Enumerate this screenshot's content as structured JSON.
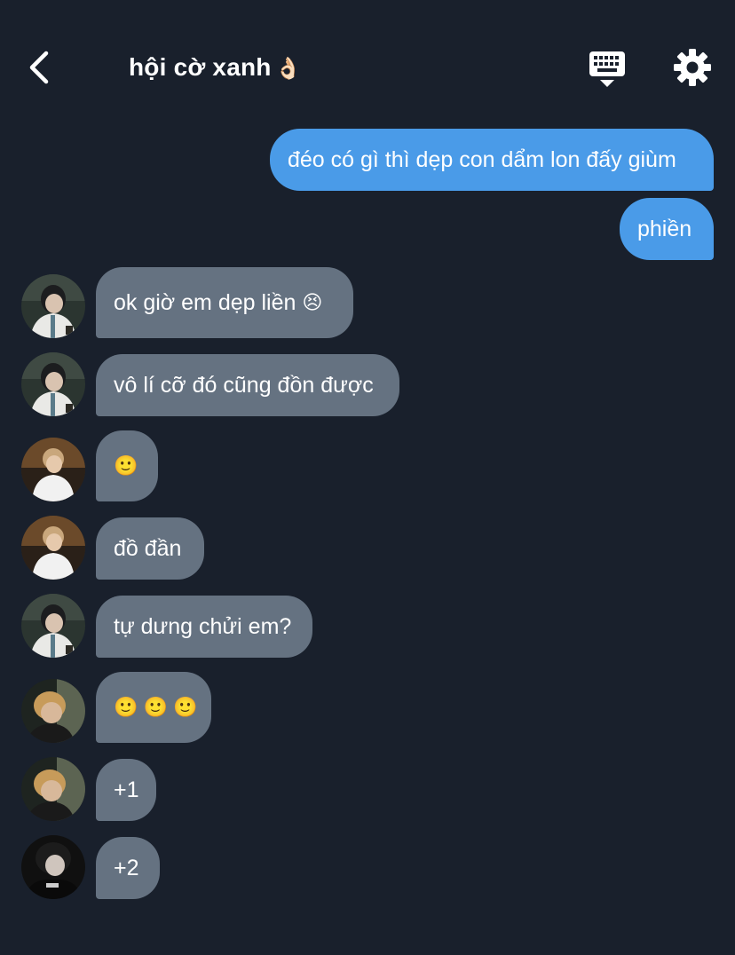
{
  "header": {
    "title": "hội cờ xanh",
    "title_emoji": "👌🏻",
    "icons": {
      "back": "chevron-left-icon",
      "keyboard": "keyboard-icon",
      "settings": "gear-icon"
    }
  },
  "messages": [
    {
      "dir": "out",
      "text": "đéo có gì thì dẹp con dẩm lon đấy giùm"
    },
    {
      "dir": "out",
      "text": "phiền"
    },
    {
      "dir": "in",
      "avatar": "a",
      "text": "ok giờ em dẹp liền",
      "emoji": "😣"
    },
    {
      "dir": "in",
      "avatar": "a",
      "text": "vô lí cỡ đó cũng đồn được"
    },
    {
      "dir": "in",
      "avatar": "b",
      "text": "",
      "emoji": "🙂"
    },
    {
      "dir": "in",
      "avatar": "b",
      "text": "đồ đần"
    },
    {
      "dir": "in",
      "avatar": "a",
      "text": "tự dưng chửi em?"
    },
    {
      "dir": "in",
      "avatar": "c",
      "text": "",
      "emoji": "🙂 🙂 🙂"
    },
    {
      "dir": "in",
      "avatar": "c",
      "text": "+1"
    },
    {
      "dir": "in",
      "avatar": "d",
      "text": "+2"
    }
  ],
  "colors": {
    "background": "#19202c",
    "outgoing_bubble": "#4a9be8",
    "incoming_bubble": "#657281"
  }
}
